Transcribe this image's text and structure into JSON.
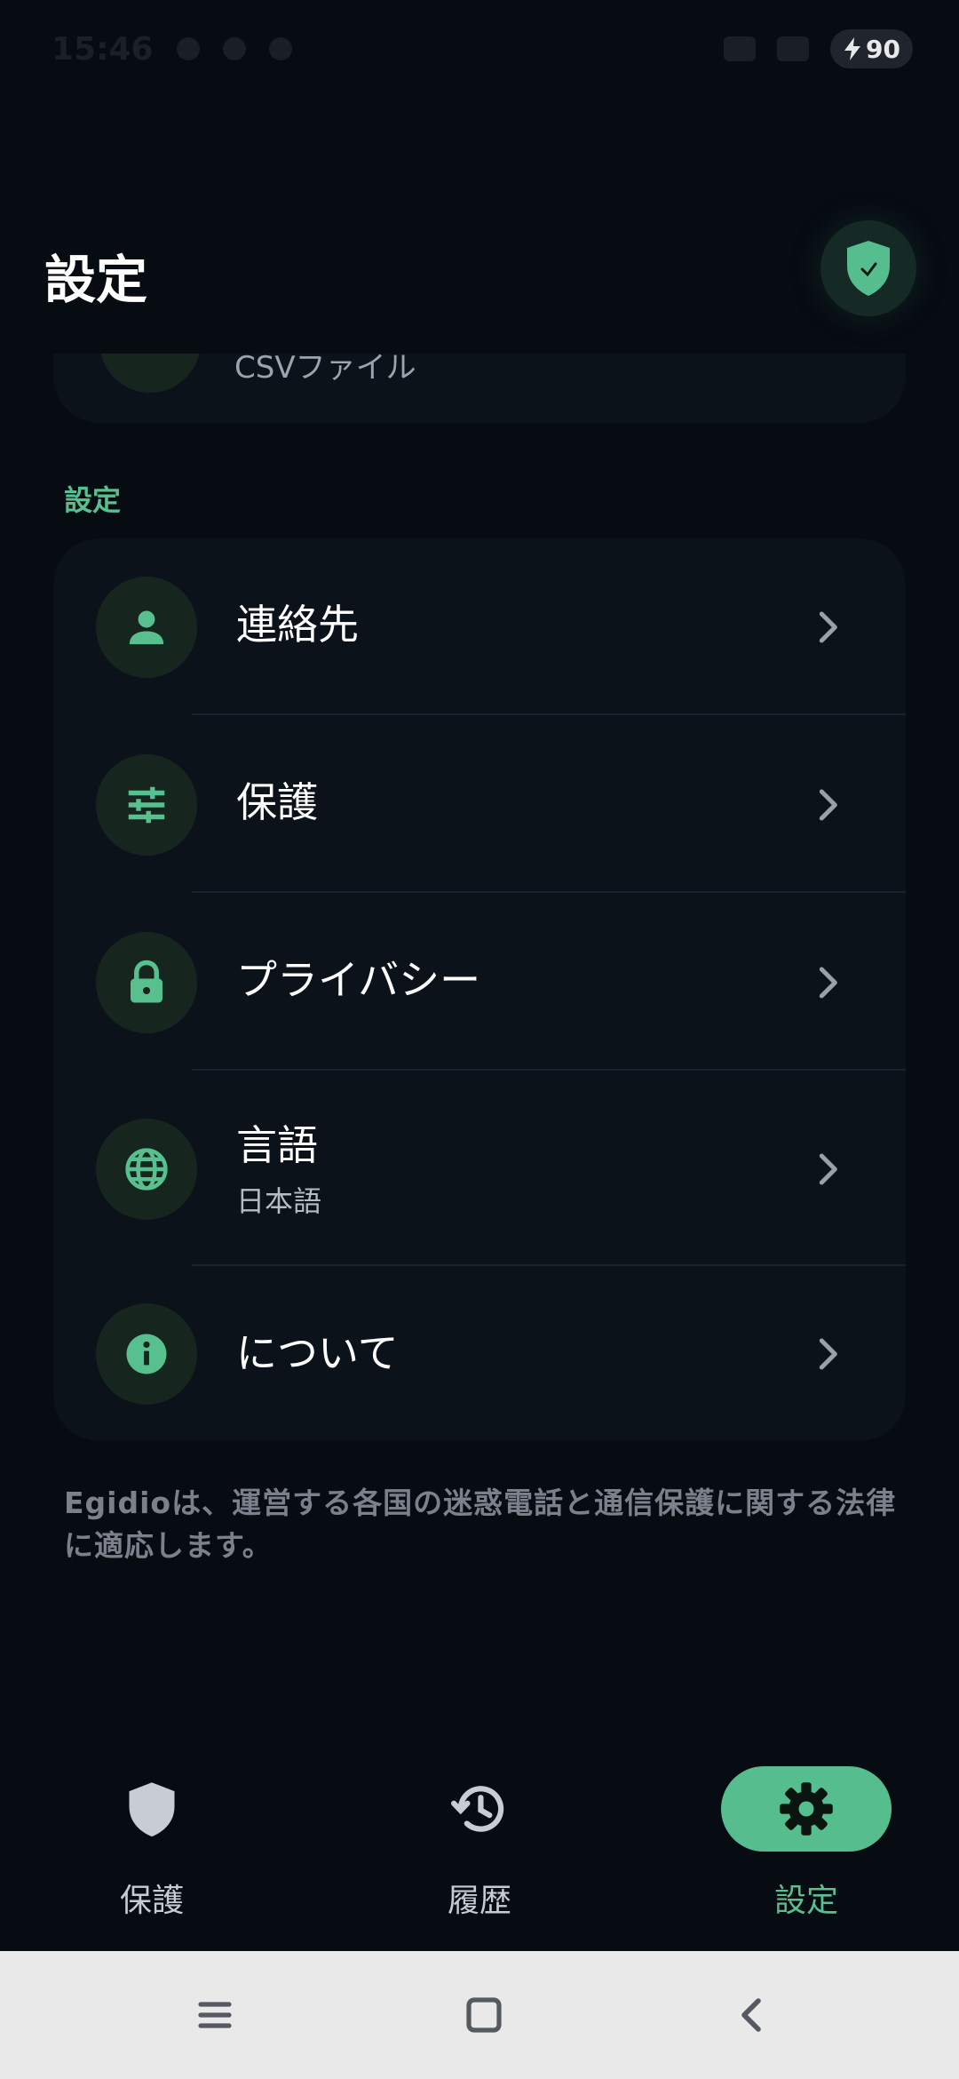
{
  "status_bar": {
    "time": "15:46",
    "battery": "90"
  },
  "header": {
    "title": "設定"
  },
  "partial_item": {
    "subtitle": "CSVファイル"
  },
  "section": {
    "label": "設定"
  },
  "settings_items": [
    {
      "icon": "person-icon",
      "title": "連絡先",
      "subtitle": ""
    },
    {
      "icon": "tune-sliders-icon",
      "title": "保護",
      "subtitle": ""
    },
    {
      "icon": "lock-icon",
      "title": "プライバシー",
      "subtitle": ""
    },
    {
      "icon": "globe-icon",
      "title": "言語",
      "subtitle": "日本語"
    },
    {
      "icon": "info-icon",
      "title": "について",
      "subtitle": ""
    }
  ],
  "footnote": "Egidioは、運営する各国の迷惑電話と通信保護に関する法律に適応します。",
  "bottom_nav": {
    "items": [
      {
        "icon": "shield-icon",
        "label": "保護",
        "active": false
      },
      {
        "icon": "history-icon",
        "label": "履歴",
        "active": false
      },
      {
        "icon": "gear-icon",
        "label": "設定",
        "active": true
      }
    ]
  },
  "colors": {
    "background": "#070b12",
    "card": "#0c1219",
    "accent": "#58bf8f",
    "icon_circle": "#17251f",
    "system_nav": "#e9e9ea"
  }
}
